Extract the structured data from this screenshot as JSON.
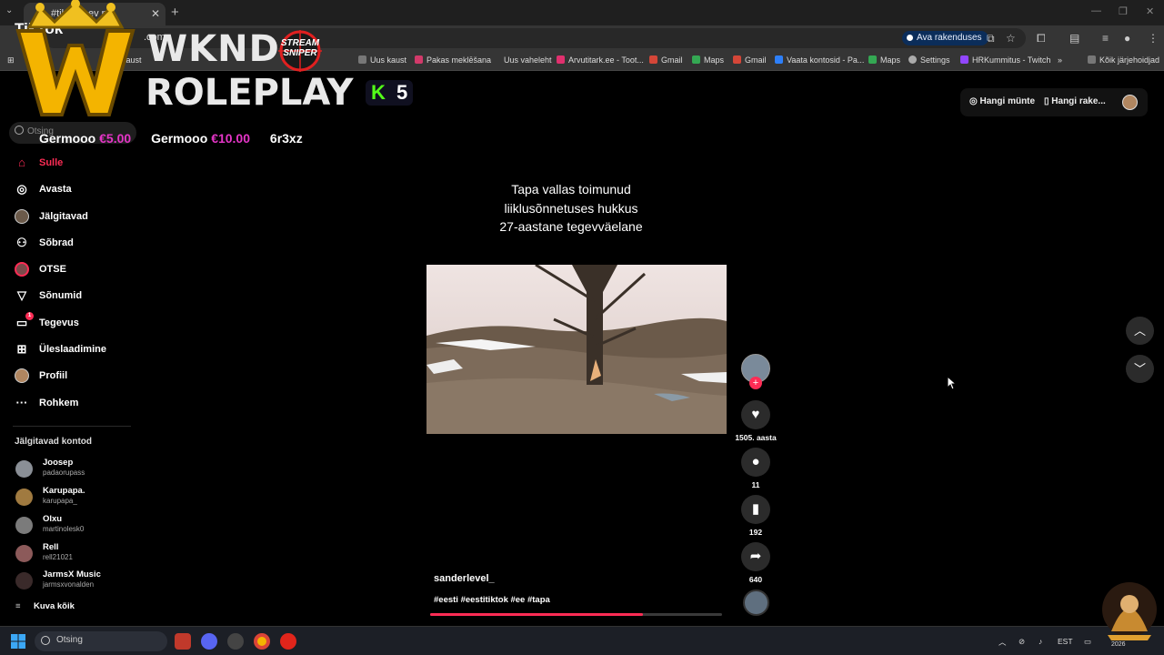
{
  "browser": {
    "tab_title": "#tiktok...ev p",
    "address_partial": ".com",
    "app_pill": "Ava rakenduses",
    "bookmarks": [
      {
        "label": "kaust",
        "color": "#888"
      },
      {
        "label": "Uus kaust",
        "color": "#888"
      },
      {
        "label": "Pakas meklēšana",
        "color": "#d23a6a"
      },
      {
        "label": "Uus vaheleht",
        "color": "#888"
      },
      {
        "label": "Arvutitark.ee - Toot...",
        "color": "#e0306e"
      },
      {
        "label": "Gmail",
        "color": "#d44638"
      },
      {
        "label": "Maps",
        "color": "#34a853"
      },
      {
        "label": "Gmail",
        "color": "#d44638"
      },
      {
        "label": "Vaata kontosid - Pa...",
        "color": "#2d7ff9"
      },
      {
        "label": "Maps",
        "color": "#34a853"
      },
      {
        "label": "Settings",
        "color": "#aaaaaa"
      },
      {
        "label": "HRKummitus - Twitch",
        "color": "#9146ff"
      },
      {
        "label": "Kõik järjehoidjad",
        "color": "#888"
      }
    ]
  },
  "overlay": {
    "line1": "WKND",
    "line2": "ROLEPLAY",
    "stream_sniper": "STREAM SNIPER",
    "kick_count": "5",
    "donations": [
      {
        "name": "Germooo",
        "amount": "€5.00"
      },
      {
        "name": "Germooo",
        "amount": "€10.00"
      },
      {
        "name": "6r3xz",
        "amount": ""
      }
    ]
  },
  "tiktok": {
    "logo": "TikTok",
    "search_placeholder": "Otsing",
    "nav": [
      {
        "label": "Sulle",
        "icon": "home-icon",
        "active": true
      },
      {
        "label": "Avasta",
        "icon": "compass-icon",
        "active": false
      },
      {
        "label": "Jälgitavad",
        "icon": "avatar-icon",
        "active": false
      },
      {
        "label": "Sõbrad",
        "icon": "friends-icon",
        "active": false
      },
      {
        "label": "OTSE",
        "icon": "live-icon",
        "active": false
      },
      {
        "label": "Sõnumid",
        "icon": "send-icon",
        "active": false
      },
      {
        "label": "Tegevus",
        "icon": "activity-icon",
        "active": false,
        "badge": "1"
      },
      {
        "label": "Üleslaadimine",
        "icon": "upload-icon",
        "active": false
      },
      {
        "label": "Profiil",
        "icon": "profile-icon",
        "active": false
      },
      {
        "label": "Rohkem",
        "icon": "more-icon",
        "active": false
      }
    ],
    "following_heading": "Jälgitavad kontod",
    "following": [
      {
        "name": "Joosep",
        "handle": "padaorupass"
      },
      {
        "name": "Karupapa.",
        "handle": "karupapa_"
      },
      {
        "name": "Olxu",
        "handle": "martinolesk0"
      },
      {
        "name": "Rell",
        "handle": "rell21021"
      },
      {
        "name": "JarmsX Music",
        "handle": "jarmsxvonalden"
      }
    ],
    "show_all": "Kuva kõik",
    "top_right": {
      "coins": "Hangi münte",
      "app": "Hangi rake..."
    },
    "video": {
      "headline_lines": [
        "Tapa vallas toimunud",
        "liiklusõnnetuses hukkus",
        "27-aastane tegevväelane"
      ],
      "author": "sanderlevel_",
      "hashtags": "#eesti #eestitiktok #ee #tapa",
      "progress": 0.73
    },
    "actions": {
      "likes": "1505. aasta",
      "comments": "11",
      "saves": "192",
      "shares": "640"
    }
  },
  "taskbar": {
    "search": "Otsing",
    "lang": "EST",
    "year": "2026"
  }
}
